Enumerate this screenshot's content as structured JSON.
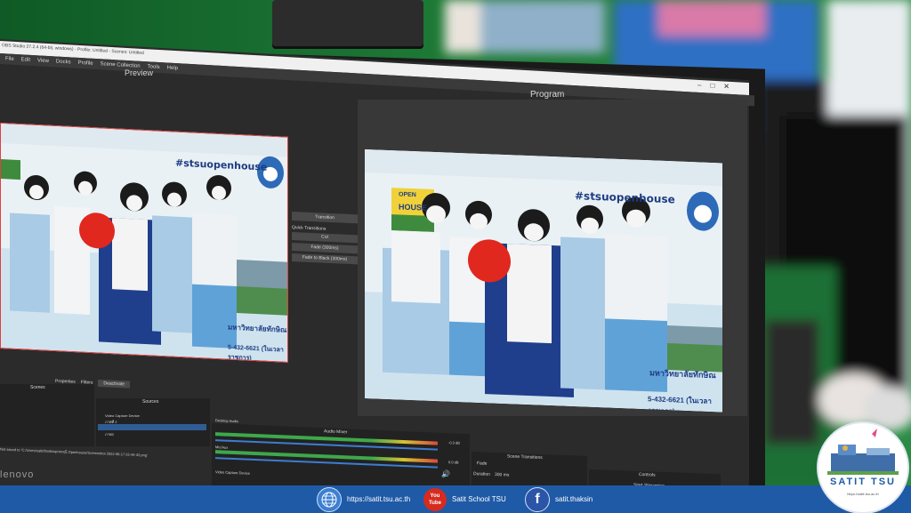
{
  "obs": {
    "title_bar": "OBS Studio 27.2.4 (64-bit, windows) - Profile: Untitled - Scenes: Untitled",
    "menu": [
      "File",
      "Edit",
      "View",
      "Docks",
      "Profile",
      "Scene Collection",
      "Tools",
      "Help"
    ],
    "preview_label": "Preview",
    "program_label": "Program",
    "transition_button": "Transition",
    "quick_transitions_label": "Quick Transitions",
    "transitions": [
      "Cut",
      "Fade (300ms)",
      "Fade to Black (300ms)"
    ],
    "toolbar": {
      "properties": "Properties",
      "filters": "Filters",
      "deactivate": "Deactivate"
    },
    "docks": {
      "scenes": "Scenes",
      "sources": "Sources",
      "audio_mixer": "Audio Mixer",
      "scene_transitions": "Scene Transitions",
      "controls": "Controls"
    },
    "sources": [
      "Video Capture Device",
      "ภาพที่ 2",
      "ภาพที่ 1",
      "ภาพ3"
    ],
    "mixer_tracks": [
      {
        "name": "Desktop Audio",
        "db": "-0.3 dB"
      },
      {
        "name": "Mic/Aux",
        "db": "0.0 dB"
      },
      {
        "name": "Video Capture Device",
        "db": ""
      }
    ],
    "scene_transition": {
      "value": "Fade",
      "duration_label": "Duration",
      "duration": "300 ms"
    },
    "start_streaming": "Start Streaming",
    "status_text": "Not saved to 'C:/Users/satit/Desktop/หกสุนี Openhouse/Screenshot 2022-08-17 02-44-42.png'"
  },
  "backdrop": {
    "hashtag": "#stsuopenhouse",
    "sign_open": "OPEN",
    "sign_house": "HOUSE",
    "university": "มหาวิทยาลัยทักษิณ",
    "phone": "5-432-6621 (ในเวลาราชการ)"
  },
  "monitor_brand": "lenovo",
  "footer": {
    "website": "https://satit.tsu.ac.th",
    "youtube_icon_text": "You Tube",
    "youtube": "Satit School TSU",
    "facebook": "satit.thaksin"
  },
  "logo": {
    "title": "SATIT TSU",
    "url": "https://satit.tsu.ac.th"
  },
  "colors": {
    "footer": "#1f5aa6",
    "obs_dark": "#2b2b2b",
    "balloon": "#e0281e",
    "logo_text": "#1f5aa6"
  },
  "icons": [
    "globe-icon",
    "youtube-icon",
    "facebook-icon"
  ]
}
